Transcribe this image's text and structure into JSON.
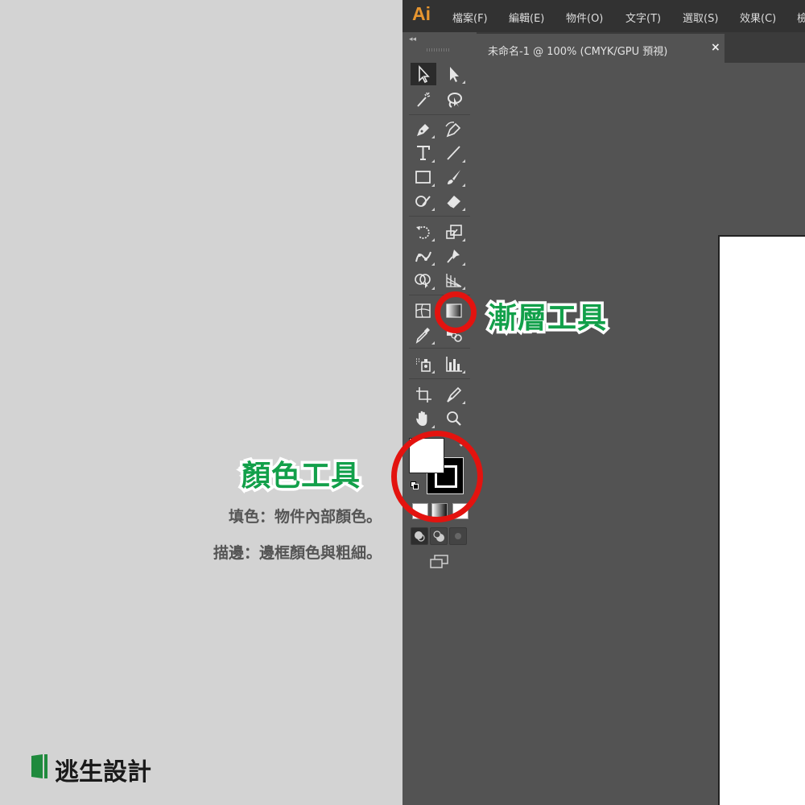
{
  "app": {
    "logo": "Ai",
    "menu": [
      "檔案(F)",
      "編輯(E)",
      "物件(O)",
      "文字(T)",
      "選取(S)",
      "效果(C)",
      "檢"
    ],
    "document_tab": "未命名-1 @ 100% (CMYK/GPU 預視)",
    "close_glyph": "×"
  },
  "annotations": {
    "gradient_label": "漸層工具",
    "color_label": "顏色工具",
    "fill_note": "填色：物件內部顏色。",
    "stroke_note": "描邊：邊框顏色與粗細。",
    "ring_color": "#e3130f",
    "label_color": "#12a04a"
  },
  "brand": {
    "name": "逃生設計",
    "color": "#1f8a3d"
  },
  "colors": {
    "menubar": "#323232",
    "panel": "#535353",
    "page_bg": "#d3d3d3",
    "logo": "#e8962f"
  }
}
